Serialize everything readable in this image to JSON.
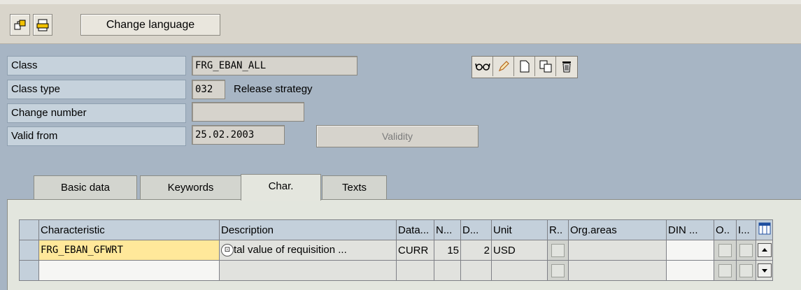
{
  "toolbar": {
    "change_language_label": "Change language",
    "icons": [
      "where-used-icon",
      "print-icon"
    ]
  },
  "header": {
    "class_label": "Class",
    "class_value": "FRG_EBAN_ALL",
    "class_type_label": "Class type",
    "class_type_value": "032",
    "class_type_text": "Release strategy",
    "change_number_label": "Change number",
    "change_number_value": "",
    "valid_from_label": "Valid from",
    "valid_from_value": "25.02.2003",
    "validity_button": "Validity",
    "object_icons": [
      "glasses-display-icon",
      "pencil-change-icon",
      "new-page-icon",
      "copy-icon",
      "trash-delete-icon"
    ]
  },
  "tabs": [
    {
      "label": "Basic data",
      "active": false
    },
    {
      "label": "Keywords",
      "active": false
    },
    {
      "label": "Char.",
      "active": true
    },
    {
      "label": "Texts",
      "active": false
    }
  ],
  "table": {
    "columns": [
      "Characteristic",
      "Description",
      "Data...",
      "N...",
      "D...",
      "Unit",
      "R..",
      "Org.areas",
      "DIN ...",
      "O..",
      "I..."
    ],
    "rows": [
      {
        "characteristic": "FRG_EBAN_GFWRT",
        "description": "tal value of requisition ...",
        "data_type": "CURR",
        "num_chars": "15",
        "decimals": "2",
        "unit": "USD"
      }
    ]
  },
  "colors": {
    "header_bg": "#a7b5c4",
    "label_bg": "#c6d2dc",
    "highlight_yellow": "#ffe89a",
    "toolbar_bg": "#d9d5cb"
  }
}
